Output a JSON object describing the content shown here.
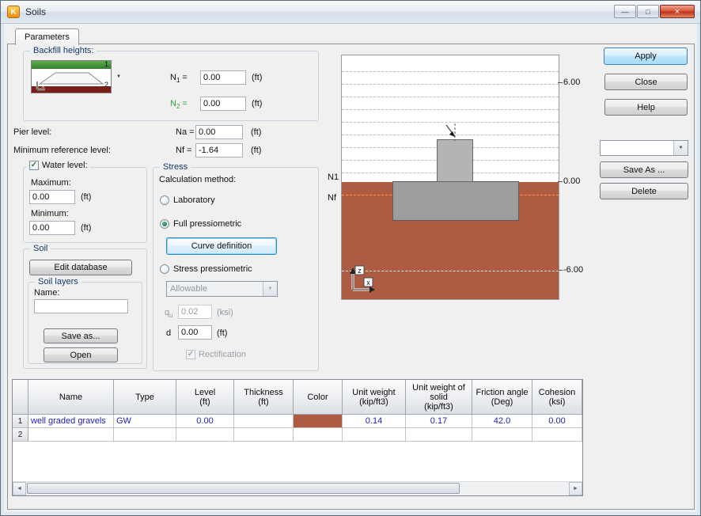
{
  "window": {
    "title": "Soils"
  },
  "icons": {
    "app_logo": "K",
    "minimize": "—",
    "maximize": "□",
    "close": "×",
    "dropdown_arrow": "▼",
    "check": "✓",
    "scroll_left": "◄",
    "scroll_right": "►"
  },
  "tab": {
    "label": "Parameters"
  },
  "backfill": {
    "group_label": "Backfill heights:",
    "layer1_num": "1",
    "layer2_num": "2",
    "axis_y": "y",
    "axis_x": "x",
    "n1_letter": "N",
    "n1_sub": "1",
    "n2_letter": "N",
    "n2_sub": "2",
    "equals": "=",
    "n1_value": "0.00",
    "n2_value": "0.00",
    "n1_unit": "(ft)",
    "n2_unit": "(ft)"
  },
  "levels": {
    "pier_label": "Pier level:",
    "na_label": "Na =",
    "na_value": "0.00",
    "na_unit": "(ft)",
    "minref_label": "Minimum reference level:",
    "nf_label": "Nf =",
    "nf_value": "-1.64",
    "nf_unit": "(ft)"
  },
  "water": {
    "group_label": "Water level:",
    "max_label": "Maximum:",
    "max_value": "0.00",
    "max_unit": "(ft)",
    "min_label": "Minimum:",
    "min_value": "0.00",
    "min_unit": "(ft)"
  },
  "stress": {
    "group_label": "Stress",
    "calc_method_label": "Calculation method:",
    "laboratory_label": "Laboratory",
    "full_pressiometric_label": "Full pressiometric",
    "curve_definition_button": "Curve definition",
    "stress_pressiometric_label": "Stress pressiometric",
    "allowable_value": "Allowable",
    "qu_letter": "q",
    "qu_sub": "u",
    "qu_value": "0.02",
    "qu_unit": "(ksi)",
    "d_label": "d",
    "d_value": "0.00",
    "d_unit": "(ft)",
    "rectification_label": "Rectification"
  },
  "soil_panel": {
    "group_label": "Soil",
    "edit_database_button": "Edit database",
    "layers_group_label": "Soil layers",
    "name_label": "Name:",
    "name_value": "",
    "save_as_button": "Save as...",
    "open_button": "Open"
  },
  "diagram": {
    "level_top": "6.00",
    "level_zero": "0.00",
    "level_bottom": "-6.00",
    "n1_label": "N1",
    "nf_label": "Nf",
    "axis_vertical": "z",
    "axis_horizontal": "x",
    "soil_color": "#ad5c43"
  },
  "actions": {
    "apply": "Apply",
    "close": "Close",
    "help": "Help",
    "preset_value": "",
    "save_as": "Save As ...",
    "delete": "Delete"
  },
  "table": {
    "headers": [
      "Name",
      "Type",
      "Level\n(ft)",
      "Thickness\n(ft)",
      "Color",
      "Unit weight\n(kip/ft3)",
      "Unit weight of\nsolid\n(kip/ft3)",
      "Friction angle\n(Deg)",
      "Cohesion\n(ksi)"
    ],
    "rows": [
      {
        "num": "1",
        "name": "well graded gravels",
        "type": "GW",
        "level": "0.00",
        "thickness": "",
        "color": "#ad5c43",
        "unit_weight": "0.14",
        "unit_weight_solid": "0.17",
        "friction_angle": "42.0",
        "cohesion": "0.00"
      },
      {
        "num": "2",
        "name": "",
        "type": "",
        "level": "",
        "thickness": "",
        "color": "",
        "unit_weight": "",
        "unit_weight_solid": "",
        "friction_angle": "",
        "cohesion": ""
      }
    ]
  }
}
